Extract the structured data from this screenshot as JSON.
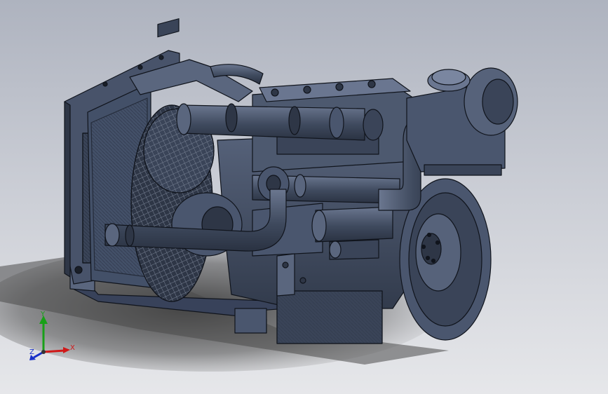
{
  "viewport": {
    "background_top": "#aeb3bf",
    "background_bottom": "#e6e7ea"
  },
  "model": {
    "body_color": "#3c4658",
    "edge_color": "#10141c",
    "highlight_color": "#6a7690"
  },
  "triad": {
    "x_label": "X",
    "y_label": "Y",
    "z_label": "Z",
    "x_color": "#d01818",
    "y_color": "#18a018",
    "z_color": "#1830c8"
  }
}
